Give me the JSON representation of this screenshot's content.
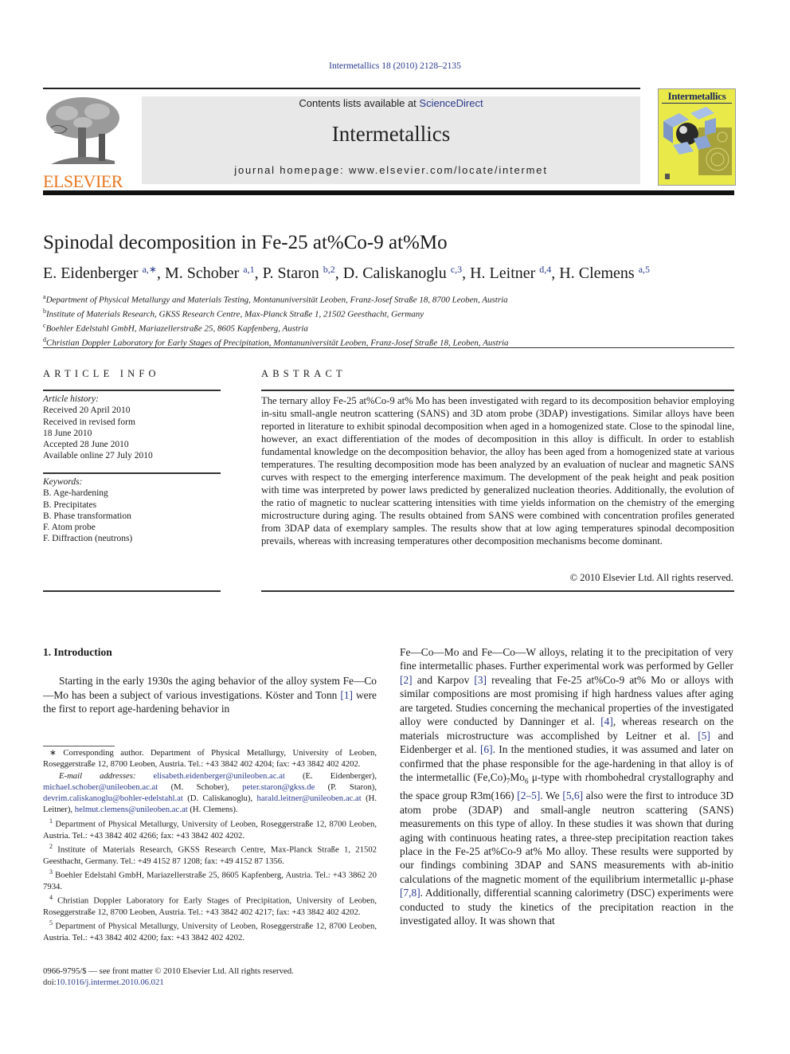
{
  "header": {
    "journal_ref": "Intermetallics 18 (2010) 2128–2135",
    "contents_prefix": "Contents lists available at ",
    "contents_link": "ScienceDirect",
    "journal_name": "Intermetallics",
    "homepage": "journal homepage: www.elsevier.com/locate/intermet",
    "publisher_wordmark": "ELSEVIER",
    "cover_title": "Intermetallics",
    "colors": {
      "link": "#2a3a8c",
      "elsevier_orange": "#e87722",
      "cover_yellow": "#e9ea4a",
      "banner_gray": "#e8e8e8"
    }
  },
  "article": {
    "title": "Spinodal decomposition in Fe-25 at%Co-9 at%Mo",
    "authors": [
      {
        "name": "E. Eidenberger",
        "sup": "a,∗"
      },
      {
        "name": "M. Schober",
        "sup": "a,1"
      },
      {
        "name": "P. Staron",
        "sup": "b,2"
      },
      {
        "name": "D. Caliskanoglu",
        "sup": "c,3"
      },
      {
        "name": "H. Leitner",
        "sup": "d,4"
      },
      {
        "name": "H. Clemens",
        "sup": "a,5"
      }
    ],
    "affiliations": [
      {
        "key": "a",
        "text": "Department of Physical Metallurgy and Materials Testing, Montanuniversität Leoben, Franz-Josef Straße 18, 8700 Leoben, Austria"
      },
      {
        "key": "b",
        "text": "Institute of Materials Research, GKSS Research Centre, Max-Planck Straße 1, 21502 Geesthacht, Germany"
      },
      {
        "key": "c",
        "text": "Boehler Edelstahl GmbH, Mariazellerstraße 25, 8605 Kapfenberg, Austria"
      },
      {
        "key": "d",
        "text": "Christian Doppler Laboratory for Early Stages of Precipitation, Montanuniversität Leoben, Franz-Josef Straße 18, Leoben, Austria"
      }
    ]
  },
  "article_info": {
    "heading": "ARTICLE INFO",
    "history_label": "Article history:",
    "history": [
      "Received 20 April 2010",
      "Received in revised form",
      "18 June 2010",
      "Accepted 28 June 2010",
      "Available online 27 July 2010"
    ],
    "keywords_label": "Keywords:",
    "keywords": [
      "B. Age-hardening",
      "B. Precipitates",
      "B. Phase transformation",
      "F. Atom probe",
      "F. Diffraction (neutrons)"
    ]
  },
  "abstract": {
    "heading": "ABSTRACT",
    "text": "The ternary alloy Fe-25 at%Co-9 at% Mo has been investigated with regard to its decomposition behavior employing in-situ small-angle neutron scattering (SANS) and 3D atom probe (3DAP) investigations. Similar alloys have been reported in literature to exhibit spinodal decomposition when aged in a homogenized state. Close to the spinodal line, however, an exact differentiation of the modes of decomposition in this alloy is difficult. In order to establish fundamental knowledge on the decomposition behavior, the alloy has been aged from a homogenized state at various temperatures. The resulting decomposition mode has been analyzed by an evaluation of nuclear and magnetic SANS curves with respect to the emerging interference maximum. The development of the peak height and peak position with time was interpreted by power laws predicted by generalized nucleation theories. Additionally, the evolution of the ratio of magnetic to nuclear scattering intensities with time yields information on the chemistry of the emerging microstructure during aging. The results obtained from SANS were combined with concentration profiles generated from 3DAP data of exemplary samples. The results show that at low aging temperatures spinodal decomposition prevails, whereas with increasing temperatures other decomposition mechanisms become dominant.",
    "copyright": "© 2010 Elsevier Ltd. All rights reserved."
  },
  "introduction": {
    "heading": "1.  Introduction",
    "p1_a": "Starting in the early 1930s the aging behavior of the alloy system Fe—Co—Mo has been a subject of various investigations. Köster and Tonn ",
    "p1_ref": "[1]",
    "p1_b": " were the first to report age-hardening behavior in",
    "col2": [
      {
        "t": "Fe—Co—Mo and Fe—Co—W alloys, relating it to the precipitation of very fine intermetallic phases. Further experimental work was performed by Geller "
      },
      {
        "ref": "[2]"
      },
      {
        "t": " and Karpov "
      },
      {
        "ref": "[3]"
      },
      {
        "t": " revealing that Fe-25 at%Co-9 at% Mo or alloys with similar compositions are most promising if high hardness values after aging are targeted. Studies concerning the mechanical properties of the investigated alloy were conducted by Danninger et al. "
      },
      {
        "ref": "[4]"
      },
      {
        "t": ", whereas research on the materials microstructure was accomplished by Leitner et al. "
      },
      {
        "ref": "[5]"
      },
      {
        "t": " and Eidenberger et al. "
      },
      {
        "ref": "[6]"
      },
      {
        "t": ". In the mentioned studies, it was assumed and later on confirmed that the phase responsible for the age-hardening in that alloy is of the intermetallic (Fe,Co)"
      },
      {
        "sub": "7"
      },
      {
        "t": "Mo"
      },
      {
        "sub": "6"
      },
      {
        "t": " μ-type with rhombohedral crystallography and the space group R3m(166) "
      },
      {
        "ref": "[2–5]"
      },
      {
        "t": ". We "
      },
      {
        "ref": "[5,6]"
      },
      {
        "t": " also were the first to introduce 3D atom probe (3DAP) and small-angle neutron scattering (SANS) measurements on this type of alloy. In these studies it was shown that during aging with continuous heating rates, a three-step precipitation reaction takes place in the Fe-25 at%Co-9 at% Mo alloy. These results were supported by our findings combining 3DAP and SANS measurements with ab-initio calculations of the magnetic moment of the equilibrium intermetallic μ-phase "
      },
      {
        "ref": "[7,8]"
      },
      {
        "t": ". Additionally, differential scanning calorimetry (DSC) experiments were conducted to study the kinetics of the precipitation reaction in the investigated alloy. It was shown that"
      }
    ]
  },
  "footnotes": {
    "corresponding": "∗ Corresponding author. Department of Physical Metallurgy, University of Leoben, Roseggerstraße 12, 8700 Leoben, Austria. Tel.: +43 3842 402 4204; fax: +43 3842 402 4202.",
    "email_label": "E-mail addresses:",
    "emails": [
      {
        "addr": "elisabeth.eidenberger@unileoben.ac.at",
        "who": "(E. Eidenberger)"
      },
      {
        "addr": "michael.schober@unileoben.ac.at",
        "who": "(M. Schober)"
      },
      {
        "addr": "peter.staron@gkss.de",
        "who": "(P. Staron)"
      },
      {
        "addr": "devrim.caliskanoglu@bohler-edelstahl.at",
        "who": "(D. Caliskanoglu)"
      },
      {
        "addr": "harald.leitner@unileoben.ac.at",
        "who": "(H. Leitner)"
      },
      {
        "addr": "helmut.clemens@unileoben.ac.at",
        "who": "(H. Clemens)."
      }
    ],
    "numbered": [
      {
        "n": "1",
        "text": "Department of Physical Metallurgy, University of Leoben, Roseggerstraße 12, 8700 Leoben, Austria. Tel.: +43 3842 402 4266; fax: +43 3842 402 4202."
      },
      {
        "n": "2",
        "text": "Institute of Materials Research, GKSS Research Centre, Max-Planck Straße 1, 21502 Geesthacht, Germany. Tel.: +49 4152 87 1208; fax: +49 4152 87 1356."
      },
      {
        "n": "3",
        "text": "Boehler Edelstahl GmbH, Mariazellerstraße 25, 8605 Kapfenberg, Austria. Tel.: +43 3862 20 7934."
      },
      {
        "n": "4",
        "text": "Christian Doppler Laboratory for Early Stages of Precipitation, University of Leoben, Roseggerstraße 12, 8700 Leoben, Austria. Tel.: +43 3842 402 4217; fax: +43 3842 402 4202."
      },
      {
        "n": "5",
        "text": "Department of Physical Metallurgy, University of Leoben, Roseggerstraße 12, 8700 Leoben, Austria. Tel.: +43 3842 402 4200; fax: +43 3842 402 4202."
      }
    ]
  },
  "front_matter": {
    "issn_line": "0966-9795/$ — see front matter © 2010 Elsevier Ltd. All rights reserved.",
    "doi_prefix": "doi:",
    "doi": "10.1016/j.intermet.2010.06.021"
  }
}
